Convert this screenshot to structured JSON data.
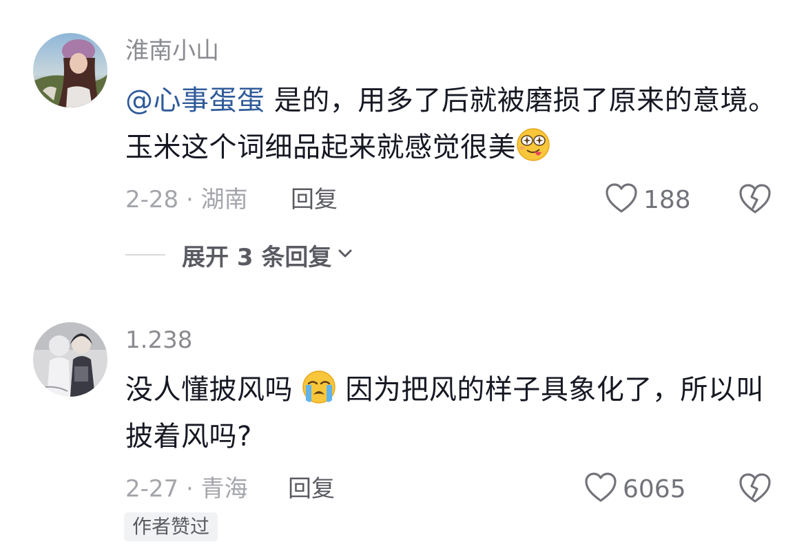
{
  "comments": [
    {
      "username": "淮南小山",
      "mention": "@心事蛋蛋",
      "text_part1": " 是的，用多了后就被磨损了原来的意境。玉米这个词细品起来就感觉很美",
      "emoji": "drooling-face-emoji",
      "date_location": "2-28 · 湖南",
      "reply_label": "回复",
      "likes": "188",
      "expand_label": "展开 3 条回复"
    },
    {
      "username": "1.238",
      "text_part1": "没人懂披风吗 ",
      "emoji": "loudly-crying-face-emoji",
      "text_part2": " 因为把风的样子具象化了，所以叫披着风吗?",
      "date_location": "2-27 · 青海",
      "reply_label": "回复",
      "likes": "6065",
      "badge": "作者赞过"
    }
  ],
  "icons": {
    "like": "heart-outline-icon",
    "dislike": "broken-heart-icon",
    "expand": "chevron-down-icon"
  },
  "colors": {
    "mention": "#2f5b9a",
    "text": "#161823",
    "muted": "#a4a5ab"
  }
}
